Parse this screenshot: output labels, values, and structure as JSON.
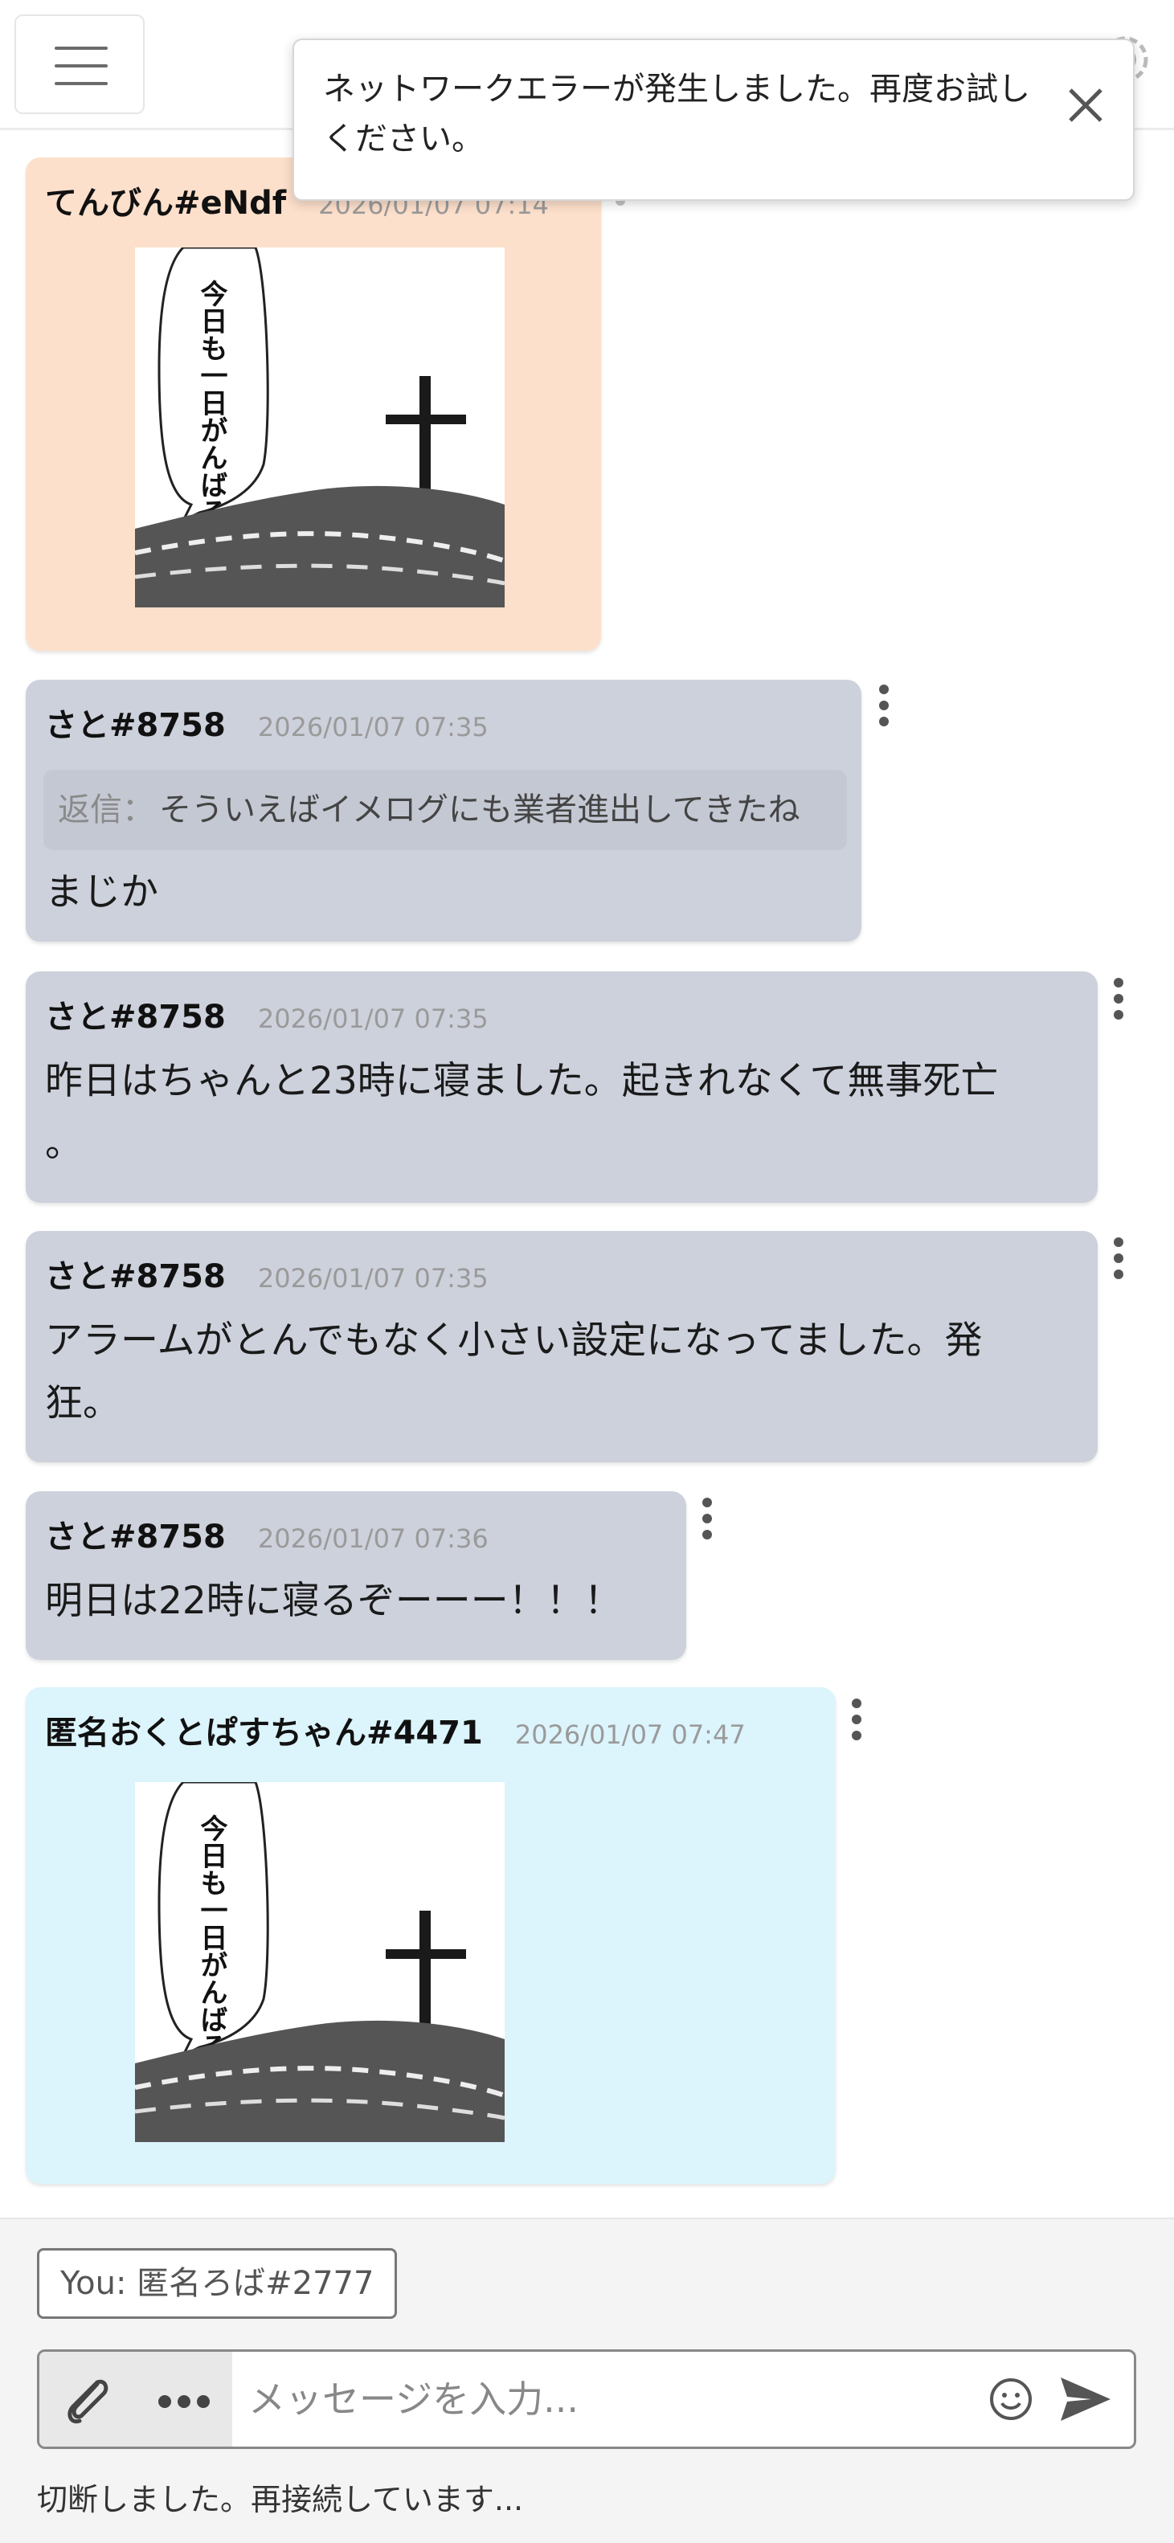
{
  "toast": {
    "message": "ネットワークエラーが発生しました。再度お試しください。"
  },
  "messages": [
    {
      "author": "てんびん#eNdf",
      "time": "2026/01/07 07:14",
      "sticker_text": "今日も一日がんばるぞい！"
    },
    {
      "author": "さと#8758",
      "time": "2026/01/07 07:35",
      "reply_label": "返信：",
      "reply_text": "そういえばイメログにも業者進出してきたね",
      "text": "まじか"
    },
    {
      "author": "さと#8758",
      "time": "2026/01/07 07:35",
      "text_line1": "昨日はちゃんと23時に寝ました。起きれなくて無事死亡",
      "text_line2": "。"
    },
    {
      "author": "さと#8758",
      "time": "2026/01/07 07:35",
      "text_line1": "アラームがとんでもなく小さい設定になってました。発",
      "text_line2": "狂。"
    },
    {
      "author": "さと#8758",
      "time": "2026/01/07 07:36",
      "text": "明日は22時に寝るぞーーー！！！"
    },
    {
      "author": "匿名おくとぱすちゃん#4471",
      "time": "2026/01/07 07:47",
      "sticker_text": "今日も一日がんばるぞい！"
    }
  ],
  "composer": {
    "you_label": "You: 匿名ろば#2777",
    "placeholder": "メッセージを入力...",
    "status": "切断しました。再接続しています..."
  },
  "colors": {
    "grey_bubble": "#cdd1dc",
    "peach_bubble": "#fde0cb",
    "cyan_bubble": "#dcf4fc"
  }
}
